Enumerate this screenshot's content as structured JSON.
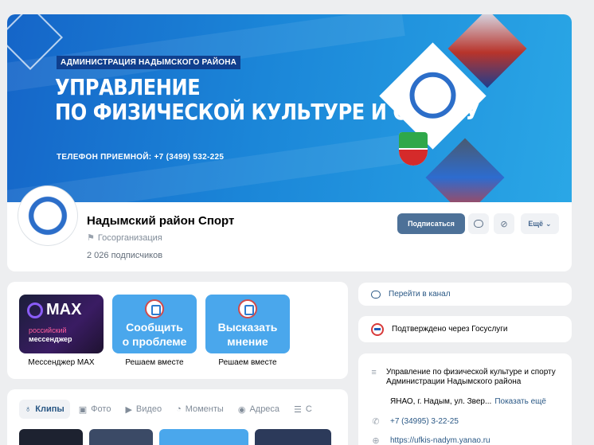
{
  "cover": {
    "admin_label": "АДМИНИСТРАЦИЯ НАДЫМСКОГО РАЙОНА",
    "title_line1": "УПРАВЛЕНИЕ",
    "title_line2": "ПО ФИЗИЧЕСКОЙ КУЛЬТУРЕ И СПОРТУ",
    "phone": "ТЕЛЕФОН ПРИЕМНОЙ: +7 (3499) 532-225"
  },
  "group": {
    "name": "Надымский район Спорт",
    "type": "Госорганизация",
    "followers": "2 026 подписчиков"
  },
  "actions": {
    "subscribe": "Подписаться",
    "more": "Ещё"
  },
  "apps": [
    {
      "logo": "MAX",
      "sub_line1": "российский",
      "sub_line2": "мессенджер",
      "caption": "Мессенджер MAX"
    },
    {
      "line1": "Сообщить",
      "line2": "о проблеме",
      "caption": "Решаем вместе"
    },
    {
      "line1": "Высказать",
      "line2": "мнение",
      "caption": "Решаем вместе"
    }
  ],
  "tabs": [
    {
      "label": "Клипы",
      "icon": "clips-icon"
    },
    {
      "label": "Фото",
      "icon": "photo-icon"
    },
    {
      "label": "Видео",
      "icon": "video-icon"
    },
    {
      "label": "Моменты",
      "icon": "moments-icon"
    },
    {
      "label": "Адреса",
      "icon": "location-icon"
    },
    {
      "label": "С",
      "icon": "text-icon"
    }
  ],
  "sidebar": {
    "channel": "Перейти в канал",
    "gosuslugi": "Подтверждено через Госуслуги",
    "description": "Управление по физической культуре и спорту Администрации Надымского района",
    "address": "ЯНАО, г. Надым, ул. Звер...",
    "show_more": "Показать ещё",
    "phone": "+7 (34995) 3-22-25",
    "site": "https://ufkis-nadym.yanao.ru"
  },
  "colors": {
    "accent": "#4d7198",
    "link": "#2a5885",
    "cover": "#1b86d8",
    "tile_blue": "#4aa7ec"
  }
}
